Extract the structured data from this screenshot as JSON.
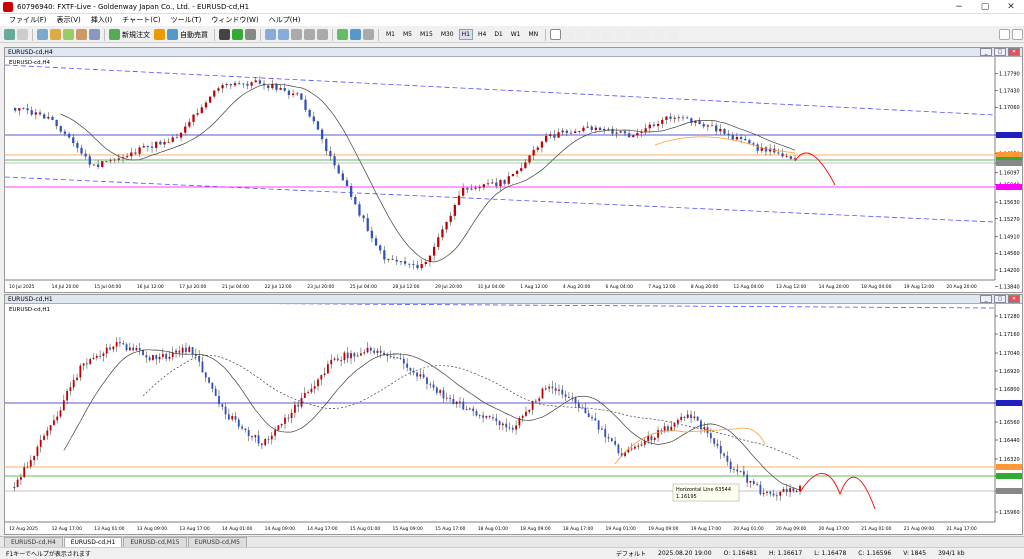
{
  "window": {
    "title": "60796940: FXTF-Live - Goldenway Japan Co., Ltd. - EURUSD-cd,H1"
  },
  "menu": [
    "ファイル(F)",
    "表示(V)",
    "挿入(I)",
    "チャート(C)",
    "ツール(T)",
    "ウィンドウ(W)",
    "ヘルプ(H)"
  ],
  "toolbar": {
    "new_order": "新規注文",
    "auto_trading": "自動売買",
    "timeframes": [
      "M1",
      "M5",
      "M15",
      "M30",
      "H1",
      "H4",
      "D1",
      "W1",
      "MN"
    ],
    "active_timeframe": "H1"
  },
  "charts": [
    {
      "name": "EURUSD-cd,H4",
      "label": "EURUSD-cd,H4",
      "price_labels": [
        "1.17790",
        "1.17430",
        "1.17060",
        "1.16694",
        "1.16350",
        "1.16190",
        "1.16097",
        "1.15940",
        "1.15630",
        "1.15270",
        "1.14910",
        "1.14560",
        "1.14200",
        "1.13840"
      ],
      "time_labels": [
        "10 Jul 2025",
        "14 Jul 20:00",
        "15 Jul 04:00",
        "16 Jul 12:00",
        "17 Jul 20:00",
        "21 Jul 04:00",
        "22 Jul 12:00",
        "23 Jul 20:00",
        "25 Jul 04:00",
        "28 Jul 12:00",
        "29 Jul 20:00",
        "31 Jul 04:00",
        "1 Aug 12:00",
        "4 Aug 20:00",
        "6 Aug 04:00",
        "7 Aug 12:00",
        "8 Aug 20:00",
        "12 Aug 04:00",
        "13 Aug 12:00",
        "14 Aug 20:00",
        "18 Aug 04:00",
        "19 Aug 12:00",
        "20 Aug 20:00"
      ]
    },
    {
      "name": "EURUSD-cd,H1",
      "label": "EURUSD-cd,H1",
      "price_labels": [
        "1.17280",
        "1.17160",
        "1.17040",
        "1.16920",
        "1.16800",
        "1.16694",
        "1.16560",
        "1.16440",
        "1.16320",
        "1.16195",
        "1.16097",
        "1.15960"
      ],
      "time_labels": [
        "12 Aug 2025",
        "12 Aug 17:00",
        "13 Aug 01:00",
        "13 Aug 09:00",
        "13 Aug 17:00",
        "14 Aug 01:00",
        "14 Aug 09:00",
        "14 Aug 17:00",
        "15 Aug 01:00",
        "15 Aug 09:00",
        "15 Aug 17:00",
        "18 Aug 01:00",
        "18 Aug 09:00",
        "18 Aug 17:00",
        "19 Aug 01:00",
        "19 Aug 09:00",
        "19 Aug 17:00",
        "20 Aug 01:00",
        "20 Aug 09:00",
        "20 Aug 17:00",
        "21 Aug 01:00",
        "21 Aug 09:00",
        "21 Aug 17:00"
      ],
      "tooltip": {
        "line1": "Horizontal Line 63544",
        "line2": "1.16195"
      }
    }
  ],
  "tabs": [
    "EURUSD-cd,H4",
    "EURUSD-cd,H1",
    "EURUSD-cd,M15",
    "EURUSD-cd,M5"
  ],
  "active_tab": "EURUSD-cd,H1",
  "status": {
    "help": "F1キーでヘルプが表示されます",
    "profile": "デフォルト",
    "datetime": "2025.08.20 19:00",
    "open": "O: 1.16481",
    "high": "H: 1.16617",
    "low": "L: 1.16478",
    "close": "C: 1.16596",
    "volume": "V: 1845",
    "traffic": "394/1 kb"
  },
  "colors": {
    "bull": "#c00000",
    "bear": "#3050c0",
    "channel": "#5050ff",
    "resistance": "#2020c0",
    "support_magenta": "#ff00ff",
    "orange_line": "#ff9933",
    "green_line": "#33aa33",
    "forecast": "#ff0000",
    "ma": "#404040"
  }
}
